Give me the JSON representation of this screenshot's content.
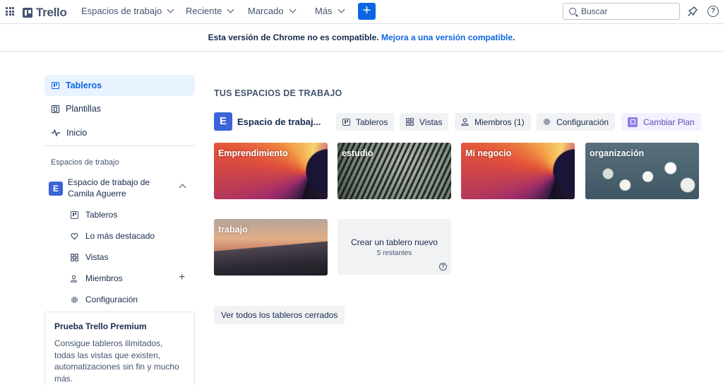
{
  "topnav": {
    "app_name": "Trello",
    "menus": [
      "Espacios de trabajo",
      "Reciente",
      "Marcado",
      "Más"
    ],
    "create_label": "+",
    "search_placeholder": "Buscar"
  },
  "banner": {
    "text": "Esta versión de Chrome no es compatible.",
    "link": "Mejora a una versión compatible",
    "suffix": "."
  },
  "sidebar": {
    "items": [
      {
        "label": "Tableros",
        "icon": "board-icon",
        "active": true
      },
      {
        "label": "Plantillas",
        "icon": "template-icon"
      },
      {
        "label": "Inicio",
        "icon": "pulse-icon"
      }
    ],
    "section_heading": "Espacios de trabajo",
    "workspace": {
      "badge": "E",
      "name": "Espacio de trabajo de Camila Aguerre"
    },
    "sub_items": [
      {
        "label": "Tableros",
        "icon": "board-icon"
      },
      {
        "label": "Lo más destacado",
        "icon": "heart-icon"
      },
      {
        "label": "Vistas",
        "icon": "grid-icon"
      },
      {
        "label": "Miembros",
        "icon": "members-icon"
      },
      {
        "label": "Configuración",
        "icon": "gear-icon"
      }
    ],
    "premium": {
      "title": "Prueba Trello Premium",
      "text": "Consigue tableros ilimitados, todas las vistas que existen, automatizaciones sin fin y mucho más."
    }
  },
  "main": {
    "heading": "TUS ESPACIOS DE TRABAJO",
    "workspace_badge": "E",
    "workspace_name": "Espacio de trabaj...",
    "buttons": [
      "Tableros",
      "Vistas",
      "Miembros (1)",
      "Configuración",
      "Cambiar Plan"
    ],
    "boards": [
      {
        "title": "Emprendimiento"
      },
      {
        "title": "estudio"
      },
      {
        "title": "Mi negocio"
      },
      {
        "title": "organización"
      },
      {
        "title": "trabajo"
      }
    ],
    "new_board": {
      "label": "Crear un tablero nuevo",
      "remaining": "5 restantes"
    },
    "closed_boards_label": "Ver todos los tableros cerrados"
  },
  "colors": {
    "accent": "#0c66e4",
    "workspace_badge": "#3c64d6",
    "premium_purple": "#8f7ee7"
  }
}
